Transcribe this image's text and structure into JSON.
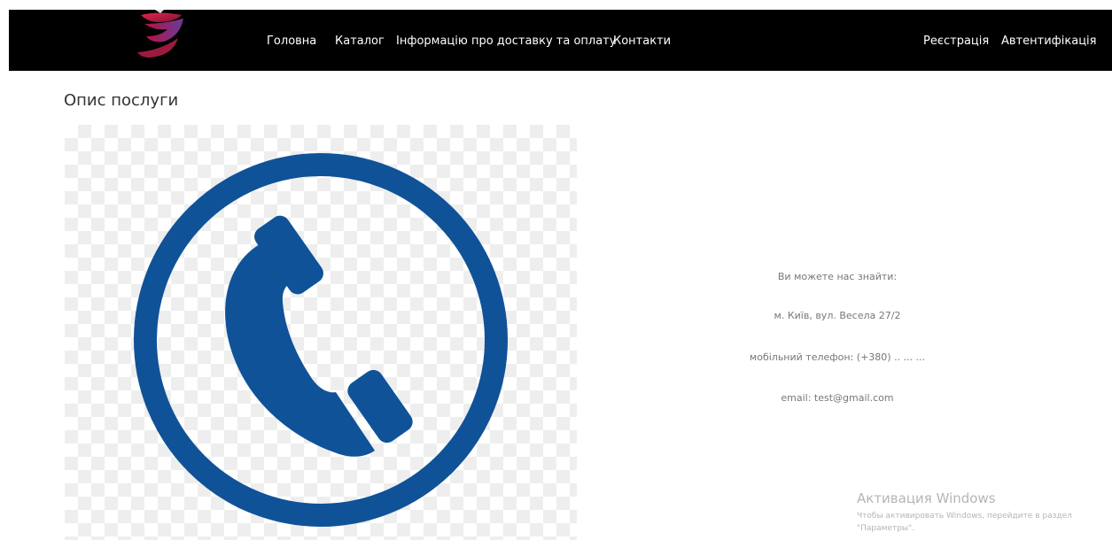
{
  "header": {
    "logo_icon": "swirl-logo-icon",
    "nav_left": [
      "Головна",
      "Каталог",
      "Інформацію про доставку та оплату",
      "Контакти"
    ],
    "nav_right": [
      "Реєстрація",
      "Автентифікація"
    ]
  },
  "main": {
    "title": "Опис послуги",
    "image_icon": "phone-handset-circle-icon",
    "accent_color": "#0f5298",
    "contact_info": {
      "intro": "Ви можете нас знайти:",
      "address": "м. Київ, вул. Весела 27/2",
      "phone": "мобільний телефон: (+380) .. ... ...",
      "email": "email: test@gmail.com"
    }
  },
  "watermark": {
    "title": "Активация Windows",
    "line1": "Чтобы активировать Windows, перейдите в раздел",
    "line2": "\"Параметры\"."
  }
}
